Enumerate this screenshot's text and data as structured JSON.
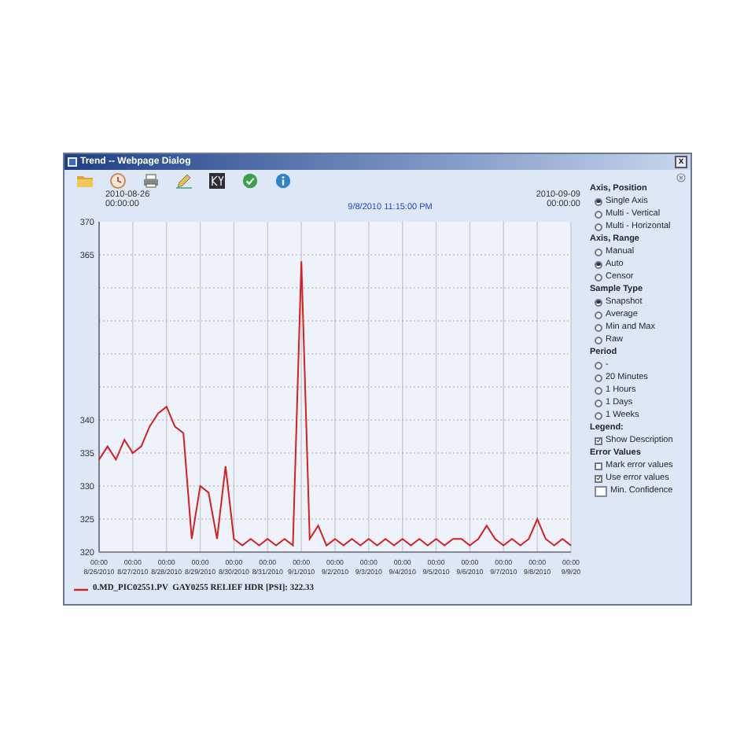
{
  "window": {
    "title": "Trend -- Webpage Dialog",
    "close": "x"
  },
  "range": {
    "start_date": "2010-08-26",
    "start_time": "00:00:00",
    "cursor": "9/8/2010 11:15:00 PM",
    "end_date": "2010-09-09",
    "end_time": "00:00:00"
  },
  "chart": {
    "chart_data": {
      "type": "line",
      "categories": [
        "00:00\n8/26/2010",
        null,
        null,
        null,
        "00:00\n8/27/2010",
        null,
        null,
        null,
        "00:00\n8/28/2010",
        null,
        null,
        null,
        "00:00\n8/29/2010",
        null,
        null,
        null,
        "00:00\n8/30/2010",
        null,
        null,
        null,
        "00:00\n8/31/2010",
        null,
        null,
        null,
        "00:00\n9/1/2010",
        null,
        null,
        null,
        "00:00\n9/2/2010",
        null,
        null,
        null,
        "00:00\n9/3/2010",
        null,
        null,
        null,
        "00:00\n9/4/2010",
        null,
        null,
        null,
        "00:00\n9/5/2010",
        null,
        null,
        null,
        "00:00\n9/6/2010",
        null,
        null,
        null,
        "00:00\n9/7/2010",
        null,
        null,
        null,
        "00:00\n9/8/2010",
        null,
        null,
        null,
        "00:00\n9/9/20"
      ],
      "series": [
        {
          "name": "0.MD_PIC02551.PV  GAY0255 RELIEF HDR [PSI]: 322.33",
          "color": "#d42020",
          "values": [
            334,
            336,
            334,
            337,
            335,
            336,
            339,
            341,
            342,
            339,
            338,
            322,
            330,
            329,
            322,
            333,
            322,
            321,
            322,
            321,
            322,
            321,
            322,
            321,
            364,
            322,
            324,
            321,
            322,
            321,
            322,
            321,
            322,
            321,
            322,
            321,
            322,
            321,
            322,
            321,
            322,
            321,
            322,
            322,
            321,
            322,
            324,
            322,
            321,
            322,
            321,
            322,
            325,
            322,
            321,
            322,
            321
          ]
        }
      ],
      "ylim": [
        320,
        370
      ],
      "grid": true,
      "yticks": [
        320,
        325,
        330,
        335,
        340,
        365,
        370
      ]
    }
  },
  "panel": {
    "sections": [
      {
        "title": "Axis, Position",
        "items": [
          {
            "kind": "radio",
            "label": "Single Axis",
            "selected": true
          },
          {
            "kind": "radio",
            "label": "Multi - Vertical",
            "selected": false
          },
          {
            "kind": "radio",
            "label": "Multi - Horizontal",
            "selected": false
          }
        ]
      },
      {
        "title": "Axis, Range",
        "items": [
          {
            "kind": "radio",
            "label": "Manual",
            "selected": false
          },
          {
            "kind": "radio",
            "label": "Auto",
            "selected": true
          },
          {
            "kind": "radio",
            "label": "Censor",
            "selected": false
          }
        ]
      },
      {
        "title": "Sample Type",
        "items": [
          {
            "kind": "radio",
            "label": "Snapshot",
            "selected": true
          },
          {
            "kind": "radio",
            "label": "Average",
            "selected": false
          },
          {
            "kind": "radio",
            "label": "Min and Max",
            "selected": false
          },
          {
            "kind": "radio",
            "label": "Raw",
            "selected": false
          }
        ]
      },
      {
        "title": "Period",
        "items": [
          {
            "kind": "radio",
            "label": "-",
            "selected": false
          },
          {
            "kind": "radio",
            "label": "20 Minutes",
            "selected": false
          },
          {
            "kind": "radio",
            "label": "1 Hours",
            "selected": false
          },
          {
            "kind": "radio",
            "label": "1 Days",
            "selected": false
          },
          {
            "kind": "radio",
            "label": "1 Weeks",
            "selected": false
          }
        ]
      },
      {
        "title": "Legend:",
        "items": [
          {
            "kind": "checkbox",
            "label": "Show Description",
            "checked": true
          }
        ]
      },
      {
        "title": "Error Values",
        "items": [
          {
            "kind": "checkbox",
            "label": "Mark error values",
            "checked": false
          },
          {
            "kind": "checkbox",
            "label": "Use error values",
            "checked": true
          },
          {
            "kind": "field",
            "label": "Min. Confidence"
          }
        ]
      }
    ]
  }
}
